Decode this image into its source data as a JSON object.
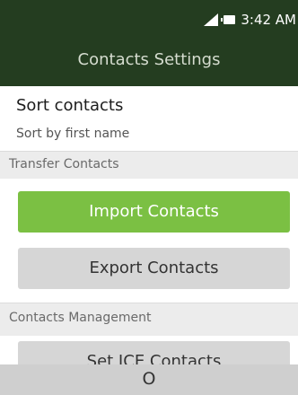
{
  "status_bar": {
    "time": "3:42 AM",
    "icons": [
      "signal-icon",
      "battery-icon"
    ]
  },
  "header": {
    "title": "Contacts Settings"
  },
  "sort": {
    "title": "Sort contacts",
    "subtitle": "Sort by first name"
  },
  "sections": {
    "transfer": "Transfer Contacts",
    "management": "Contacts Management"
  },
  "buttons": {
    "import": "Import Contacts",
    "export": "Export Contacts",
    "ice": "Set ICE Contacts"
  },
  "softkeys": {
    "center": "O"
  },
  "colors": {
    "header_bg": "#243d20",
    "accent": "#7bc043",
    "button_gray": "#d6d6d6",
    "section_bg": "#ececec",
    "softkey_bg": "#cfcfcf"
  }
}
